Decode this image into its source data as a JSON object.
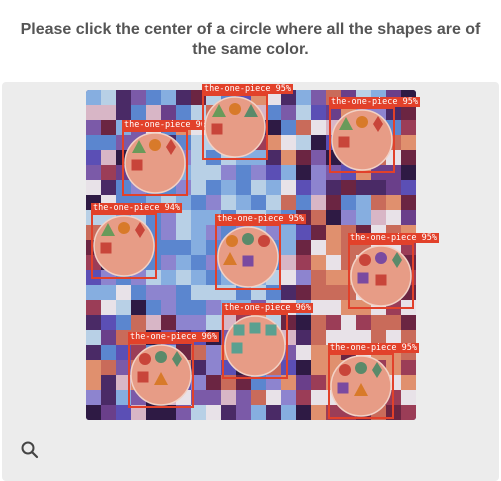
{
  "instruction": "Please click the center of a circle where all the shapes are of the same color.",
  "board": {
    "palette": [
      "#2e1a44",
      "#4a2a66",
      "#6a3f8a",
      "#7b5aa8",
      "#5b4fb5",
      "#8d84cf",
      "#5b86cf",
      "#86aee0",
      "#b8d0e6",
      "#e8e2e8",
      "#c96b5a",
      "#e0906e",
      "#9b3d57",
      "#6b2542",
      "#d8b6c6"
    ]
  },
  "circles": [
    {
      "name": "circle-1",
      "label": "the-one-piece 96%",
      "shapes": [
        {
          "t": "tri",
          "c": "#6a9a5a"
        },
        {
          "t": "circ",
          "c": "#d87a2a"
        },
        {
          "t": "dia",
          "c": "#c8453a"
        },
        {
          "t": "sq",
          "c": "#c8453a"
        }
      ]
    },
    {
      "name": "circle-2",
      "label": "the-one-piece 95%",
      "shapes": [
        {
          "t": "tri",
          "c": "#6a9a5a"
        },
        {
          "t": "circ",
          "c": "#d87a2a"
        },
        {
          "t": "tri",
          "c": "#5a8a6a"
        },
        {
          "t": "sq",
          "c": "#c8453a"
        }
      ]
    },
    {
      "name": "circle-3",
      "label": "the-one-piece 95%",
      "shapes": [
        {
          "t": "tri",
          "c": "#6a9a5a"
        },
        {
          "t": "circ",
          "c": "#d87a2a"
        },
        {
          "t": "dia",
          "c": "#c8453a"
        },
        {
          "t": "sq",
          "c": "#c8453a"
        }
      ]
    },
    {
      "name": "circle-4",
      "label": "the-one-piece 94%",
      "shapes": [
        {
          "t": "tri",
          "c": "#6a9a5a"
        },
        {
          "t": "circ",
          "c": "#d87a2a"
        },
        {
          "t": "dia",
          "c": "#c8453a"
        },
        {
          "t": "sq",
          "c": "#c8453a"
        }
      ]
    },
    {
      "name": "circle-5",
      "label": "the-one-piece 95%",
      "shapes": [
        {
          "t": "circ",
          "c": "#d87a2a"
        },
        {
          "t": "circ",
          "c": "#5a8a6a"
        },
        {
          "t": "circ",
          "c": "#c8453a"
        },
        {
          "t": "tri",
          "c": "#d87a2a"
        },
        {
          "t": "sq",
          "c": "#7a4aa0"
        }
      ]
    },
    {
      "name": "circle-6",
      "label": "the-one-piece 95%",
      "shapes": [
        {
          "t": "circ",
          "c": "#c8453a"
        },
        {
          "t": "circ",
          "c": "#7a4aa0"
        },
        {
          "t": "dia",
          "c": "#5a8a6a"
        },
        {
          "t": "sq",
          "c": "#7a4aa0"
        },
        {
          "t": "sq",
          "c": "#c8453a"
        }
      ]
    },
    {
      "name": "circle-7",
      "label": "the-one-piece 96%",
      "shapes": [
        {
          "t": "sq",
          "c": "#5aa090"
        },
        {
          "t": "sq",
          "c": "#5aa090"
        },
        {
          "t": "sq",
          "c": "#5aa090"
        },
        {
          "t": "sq",
          "c": "#5aa090"
        }
      ]
    },
    {
      "name": "circle-8",
      "label": "the-one-piece 96%",
      "shapes": [
        {
          "t": "circ",
          "c": "#c8453a"
        },
        {
          "t": "circ",
          "c": "#5a8a6a"
        },
        {
          "t": "dia",
          "c": "#5a8a6a"
        },
        {
          "t": "sq",
          "c": "#c8453a"
        },
        {
          "t": "tri",
          "c": "#d87a2a"
        }
      ]
    },
    {
      "name": "circle-9",
      "label": "the-one-piece 95%",
      "shapes": [
        {
          "t": "circ",
          "c": "#c8453a"
        },
        {
          "t": "circ",
          "c": "#5a8a6a"
        },
        {
          "t": "dia",
          "c": "#5a8a6a"
        },
        {
          "t": "sq",
          "c": "#7a4aa0"
        },
        {
          "t": "tri",
          "c": "#d87a2a"
        }
      ]
    }
  ],
  "search_icon": "magnifier-icon"
}
